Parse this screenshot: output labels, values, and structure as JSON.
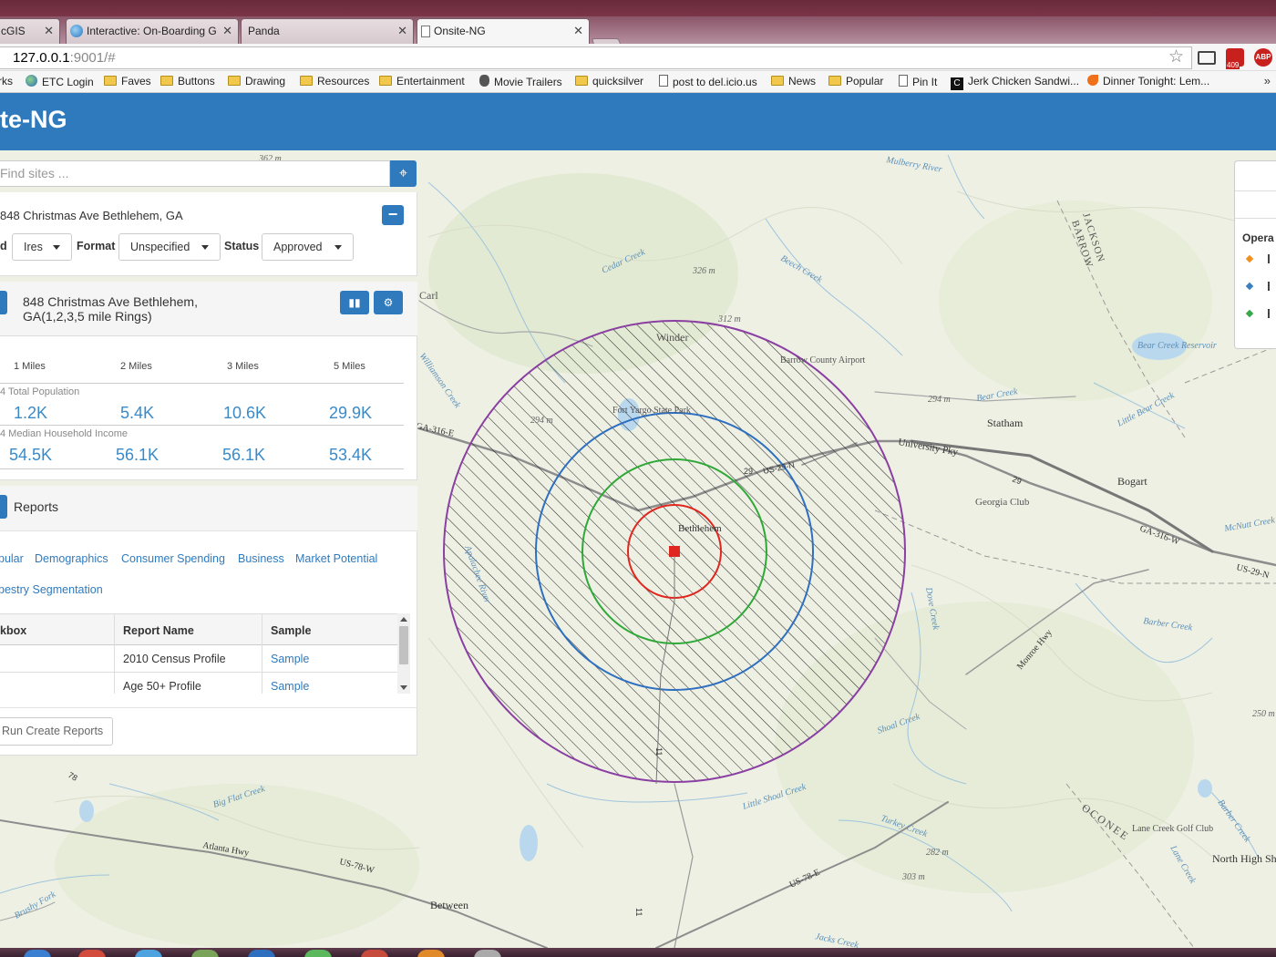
{
  "browser": {
    "tabs": [
      {
        "title": "cGIS"
      },
      {
        "title": "Interactive: On-Boarding G"
      },
      {
        "title": "Panda"
      },
      {
        "title": "Onsite-NG"
      }
    ],
    "url_host": "127.0.0.1",
    "url_path": ":9001/#",
    "ext_badge": "409",
    "abp_label": "ABP",
    "bookmarks": [
      {
        "label": "rks",
        "icon": "none"
      },
      {
        "label": "ETC Login",
        "icon": "globe"
      },
      {
        "label": "Faves",
        "icon": "folder"
      },
      {
        "label": "Buttons",
        "icon": "folder"
      },
      {
        "label": "Drawing",
        "icon": "folder"
      },
      {
        "label": "Resources",
        "icon": "folder"
      },
      {
        "label": "Entertainment",
        "icon": "folder"
      },
      {
        "label": "Movie Trailers",
        "icon": "apple"
      },
      {
        "label": "quicksilver",
        "icon": "folder"
      },
      {
        "label": "post to del.icio.us",
        "icon": "page"
      },
      {
        "label": "News",
        "icon": "folder"
      },
      {
        "label": "Popular",
        "icon": "folder"
      },
      {
        "label": "Pin It",
        "icon": "page"
      },
      {
        "label": "Jerk Chicken Sandwi...",
        "icon": "clogo"
      },
      {
        "label": "Dinner Tonight: Lem...",
        "icon": "flame"
      }
    ],
    "bookmarks_more": "»"
  },
  "app": {
    "title": "te-NG"
  },
  "search": {
    "placeholder": "Find sites ..."
  },
  "site": {
    "address": "848 Christmas Ave Bethlehem, GA",
    "filters": {
      "first_label": "d",
      "first_value": "Ires",
      "format_label": "Format",
      "format_value": "Unspecified",
      "status_label": "Status",
      "status_value": "Approved"
    }
  },
  "rings": {
    "title_line1": "848 Christmas Ave Bethlehem,",
    "title_line2": "GA(1,2,3,5 mile Rings)",
    "columns": [
      "1 Miles",
      "2 Miles",
      "3 Miles",
      "5 Miles"
    ],
    "rows": [
      {
        "label": "4 Total Population",
        "values": [
          "1.2K",
          "5.4K",
          "10.6K",
          "29.9K"
        ]
      },
      {
        "label": "4 Median Household Income",
        "values": [
          "54.5K",
          "56.1K",
          "56.1K",
          "53.4K"
        ]
      }
    ]
  },
  "reports": {
    "title": "Reports",
    "categories_row1": [
      "pular",
      "Demographics",
      "Consumer Spending",
      "Business",
      "Market Potential"
    ],
    "categories_row2": [
      "pestry Segmentation"
    ],
    "table_headers": [
      "kbox",
      "Report Name",
      "Sample"
    ],
    "table_rows": [
      {
        "name": "2010 Census Profile",
        "sample": "Sample"
      },
      {
        "name": "Age 50+ Profile",
        "sample": "Sample"
      }
    ],
    "run_button": "Run Create Reports"
  },
  "legend": {
    "title": "Opera",
    "colors": [
      "#f0901e",
      "#3a7fc0",
      "#3aa64a"
    ]
  },
  "map": {
    "labels": [
      "Winder",
      "Carl",
      "Fort Yargo State Park",
      "Barrow County Airport",
      "Statham",
      "Bogart",
      "Georgia Club",
      "Bethlehem",
      "Between",
      "North High Shoals",
      "Lane Creek Golf Club",
      "Bear Creek Reservoir",
      "University Pky",
      "GA-316-E",
      "GA-316-W",
      "US-29-N",
      "Atlanta Hwy",
      "US-78-W",
      "US-78-E",
      "Monroe Hwy",
      "JACKSON",
      "BARROW",
      "OCONEE",
      "Mulberry River",
      "Cedar Creek",
      "Beech Creek",
      "Bear Creek",
      "Little Bear Creek",
      "McNutt Creek",
      "Barber Creek",
      "Shoal Creek",
      "Little Shoal Creek",
      "Turkey Creek",
      "Big Flat Creek",
      "Brushy Fork",
      "Jacks Creek",
      "Dove Creek",
      "Williamson Creek",
      "Lane Creek",
      "Barber Creek",
      "Apalachee River"
    ],
    "elevations": [
      "362 m",
      "326 m",
      "312 m",
      "294 m",
      "294 m",
      "282 m",
      "303 m",
      "250 m"
    ],
    "road_numbers": [
      "29",
      "US-29-N",
      "78",
      "29",
      "11",
      "11"
    ],
    "ring_colors": {
      "r1": "#e0261e",
      "r2": "#2fa838",
      "r3": "#2e6fbf",
      "r5": "#8a3fa2"
    },
    "site_marker_color": "#e0261e"
  }
}
